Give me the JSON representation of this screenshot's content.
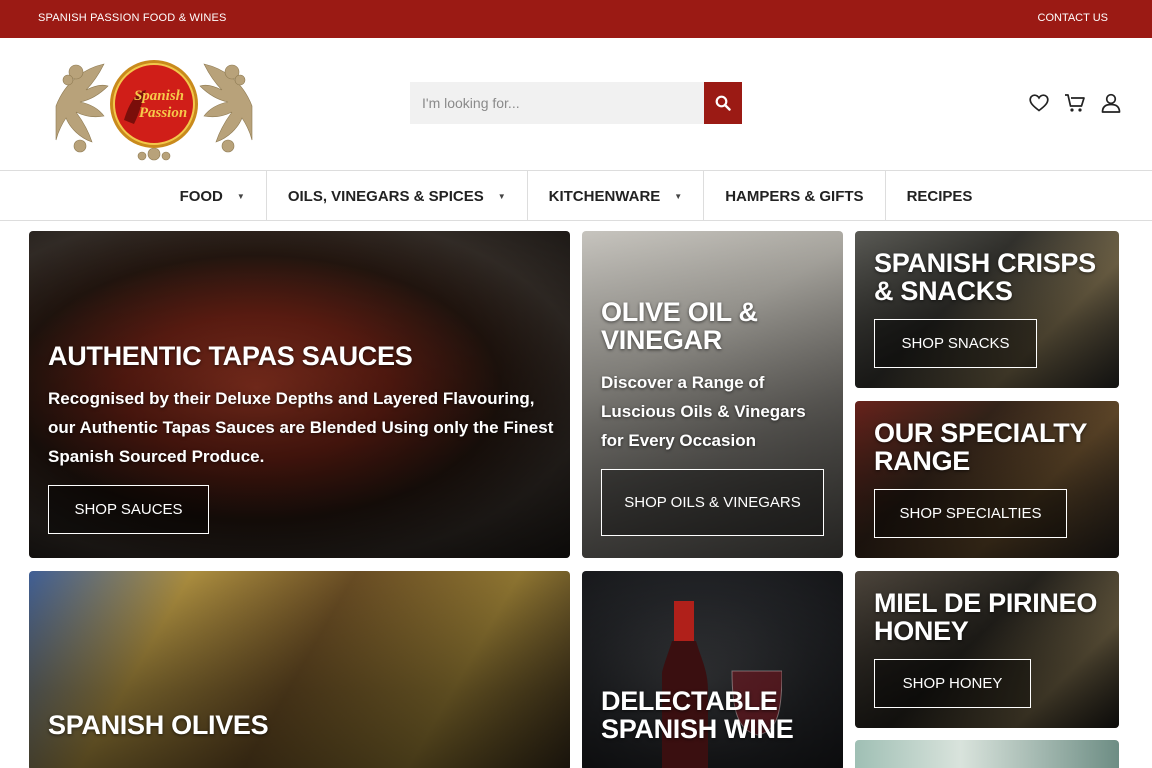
{
  "topbar": {
    "brand": "SPANISH PASSION FOOD & WINES",
    "contact": "CONTACT US"
  },
  "logo": {
    "text_line1": "Spanish",
    "text_line2": "Passion"
  },
  "search": {
    "placeholder": "I'm looking for..."
  },
  "header_icons": [
    "heart-icon",
    "cart-icon",
    "user-icon"
  ],
  "nav": {
    "items": [
      {
        "label": "FOOD",
        "has_dropdown": true
      },
      {
        "label": "OILS, VINEGARS & SPICES",
        "has_dropdown": true
      },
      {
        "label": "KITCHENWARE",
        "has_dropdown": true
      },
      {
        "label": "HAMPERS & GIFTS",
        "has_dropdown": false
      },
      {
        "label": "RECIPES",
        "has_dropdown": false
      }
    ]
  },
  "tiles": {
    "sauces": {
      "title": "AUTHENTIC TAPAS SAUCES",
      "text": "Recognised by their Deluxe Depths and Layered Flavouring, our Authentic Tapas Sauces are Blended Using only the Finest Spanish Sourced Produce.",
      "cta": "SHOP SAUCES"
    },
    "oils": {
      "title": "OLIVE OIL & VINEGAR",
      "text": "Discover a Range of Luscious Oils & Vinegars for Every Occasion",
      "cta": "SHOP OILS & VINEGARS"
    },
    "snacks": {
      "title": "SPANISH CRISPS & SNACKS",
      "cta": "SHOP SNACKS"
    },
    "specialty": {
      "title": "OUR SPECIALTY RANGE",
      "cta": "SHOP SPECIALTIES"
    },
    "olives": {
      "title": "SPANISH OLIVES"
    },
    "wine": {
      "title": "DELECTABLE SPANISH WINE"
    },
    "honey": {
      "title": "MIEL DE PIRINEO HONEY",
      "cta": "SHOP HONEY"
    }
  },
  "colors": {
    "brand_red": "#9b1a14",
    "nav_text": "#222222"
  }
}
